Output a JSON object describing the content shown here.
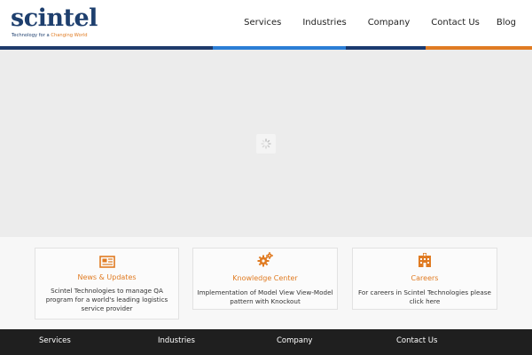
{
  "brand": {
    "name": "scintel",
    "tagline_start": "Technology for a ",
    "tagline_accent": "Changing World"
  },
  "nav": {
    "items": [
      "Services",
      "Industries",
      "Company",
      "Contact Us",
      "Blog"
    ]
  },
  "colors": {
    "brand_navy": "#1e3f6e",
    "accent_orange": "#e07b22",
    "stripe_blue": "#2b7ed6",
    "footer_bg": "#1f1f1f"
  },
  "slider": {
    "loading_icon": "spinner-icon"
  },
  "features": [
    {
      "icon": "newspaper-icon",
      "title": "News & Updates",
      "text": "Scintel Technologies to manage QA program for a world's leading logistics service provider"
    },
    {
      "icon": "gears-icon",
      "title": "Knowledge Center",
      "text": "Implementation of Model View View-Model pattern with Knockout"
    },
    {
      "icon": "building-icon",
      "title": "Careers",
      "text": "For careers in Scintel Technologies please click here"
    }
  ],
  "footer": {
    "columns": [
      "Services",
      "Industries",
      "Company",
      "Contact Us"
    ]
  }
}
